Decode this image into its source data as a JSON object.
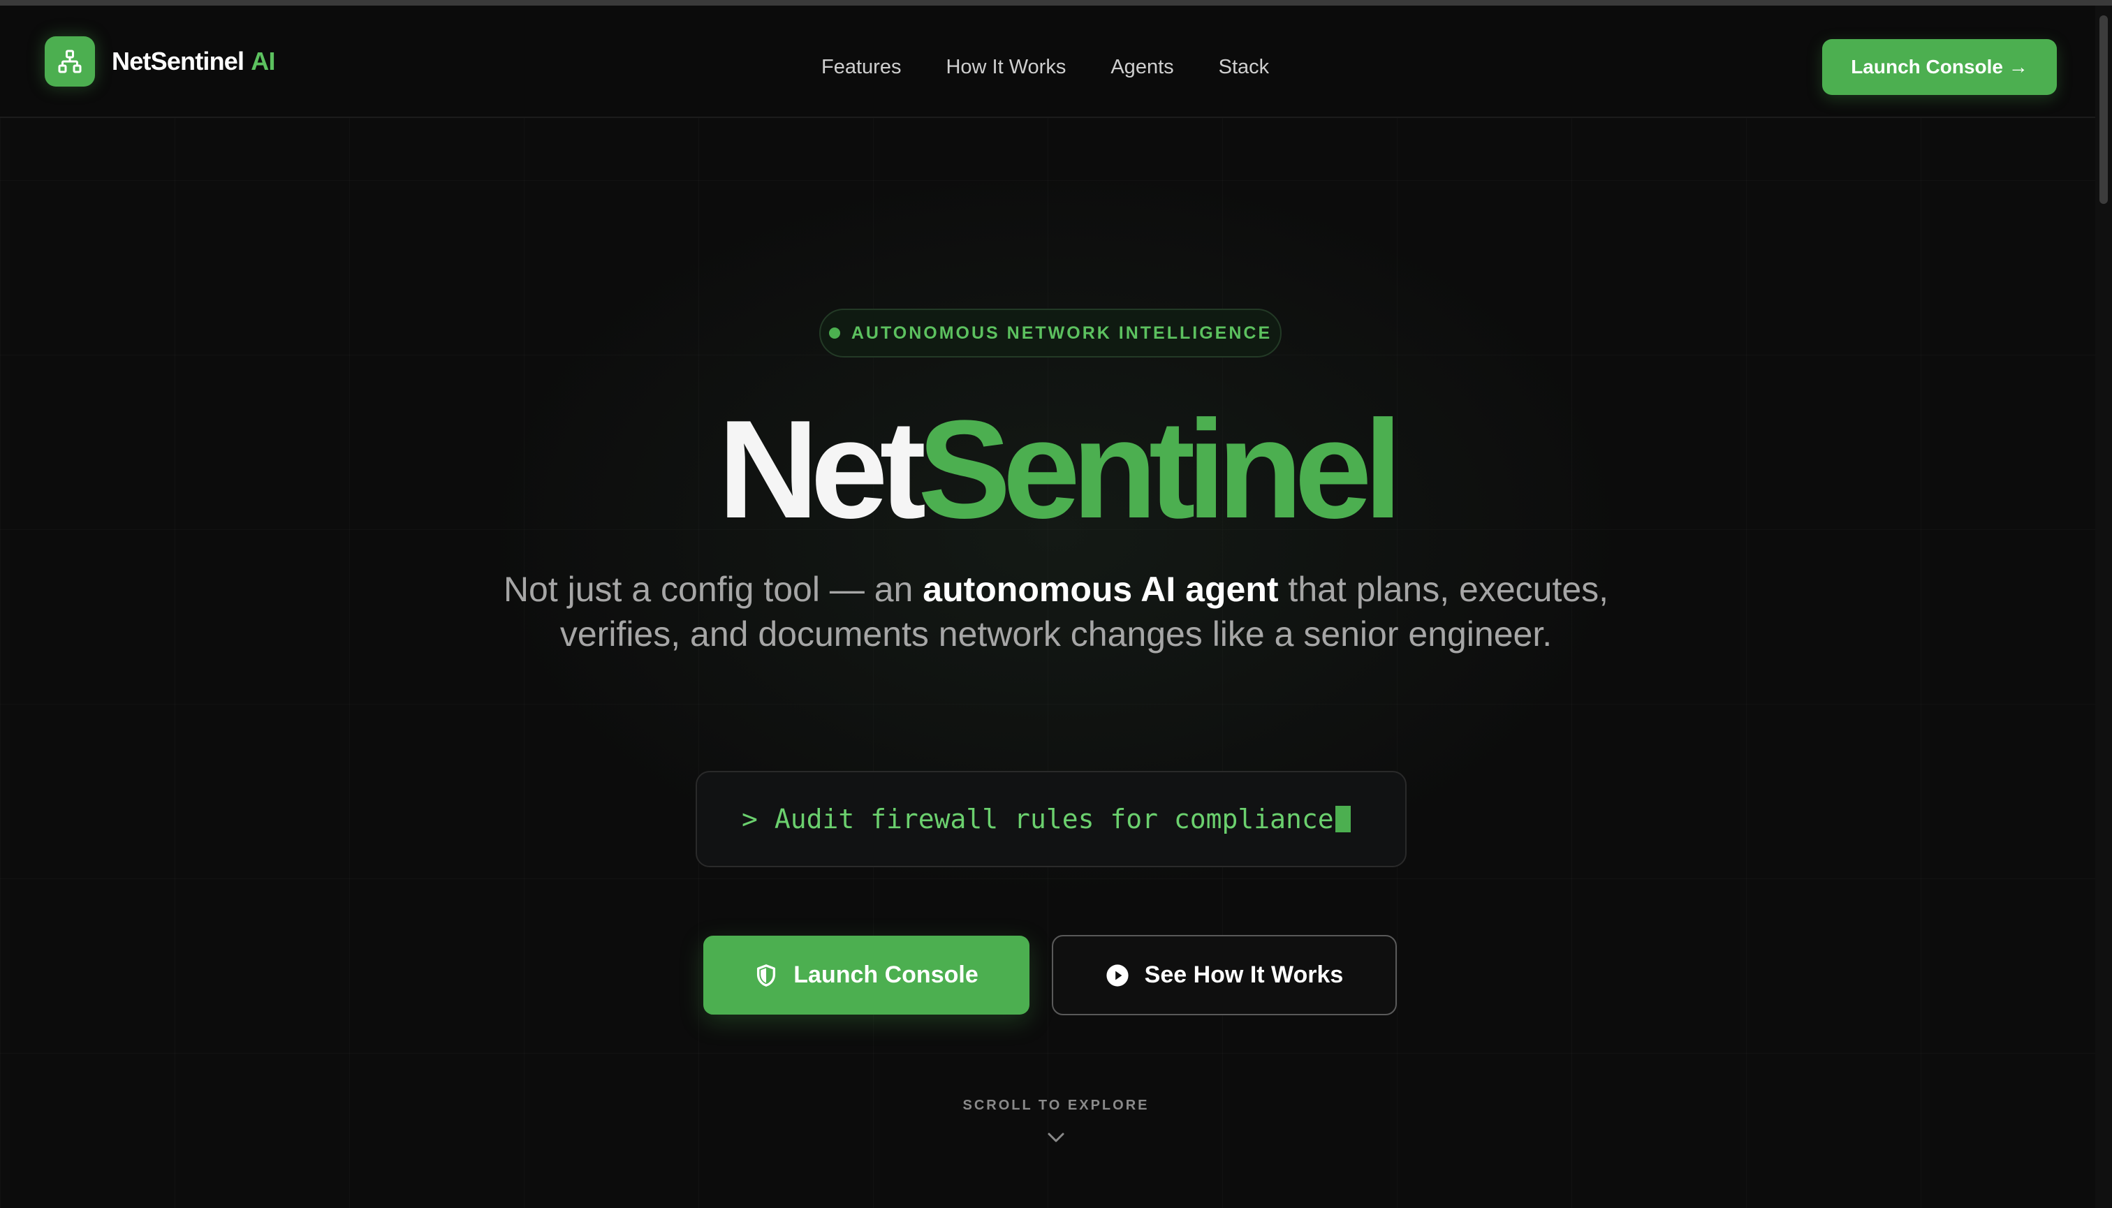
{
  "nav": {
    "brand_name": "NetSentinel",
    "brand_suffix": "AI",
    "links": [
      {
        "label": "Features"
      },
      {
        "label": "How It Works"
      },
      {
        "label": "Agents"
      },
      {
        "label": "Stack"
      }
    ],
    "cta_label": "Launch Console →"
  },
  "hero": {
    "badge": "AUTONOMOUS NETWORK INTELLIGENCE",
    "title_part1": "Net",
    "title_part2": "Sentinel",
    "subtitle_pre": "Not just a config tool — an ",
    "subtitle_bold": "autonomous AI agent",
    "subtitle_post": " that plans, executes, verifies, and documents network changes like a senior engineer.",
    "terminal_prompt": ">",
    "terminal_text": "Audit firewall rules for compliance",
    "primary_button": "Launch Console",
    "secondary_button": "See How It Works",
    "scroll_hint": "SCROLL TO EXPLORE"
  },
  "colors": {
    "accent": "#4caf50",
    "background": "#0c0c0c",
    "text": "#f5f5f5",
    "muted": "#a6a6a6"
  },
  "icons": {
    "brand": "network-icon",
    "primary_button": "shield-icon",
    "secondary_button": "play-icon",
    "scroll": "chevron-down-icon"
  }
}
